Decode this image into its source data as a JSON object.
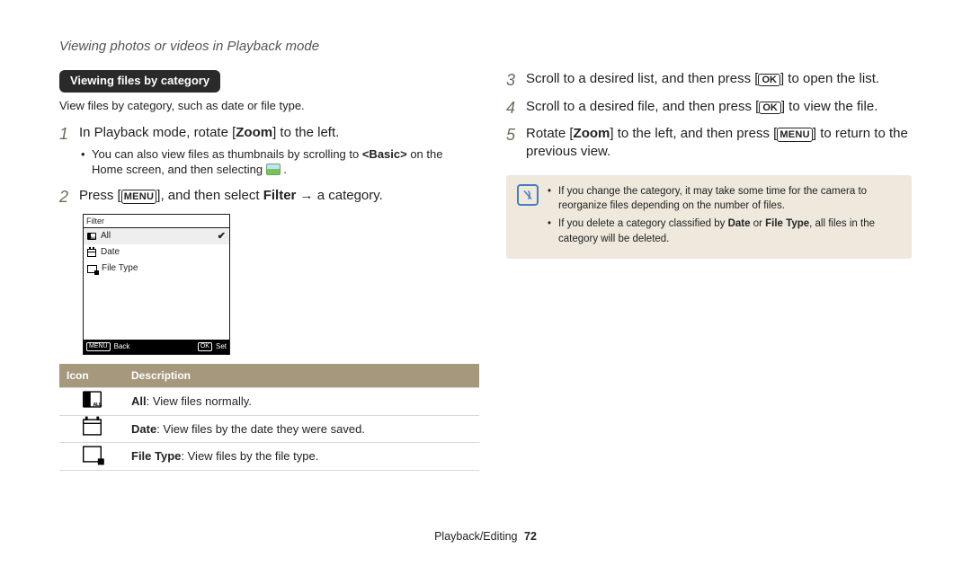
{
  "header": {
    "title": "Viewing photos or videos in Playback mode"
  },
  "section": {
    "heading": "Viewing files by category",
    "caption": "View files by category, such as date or file type."
  },
  "steps": {
    "s1": {
      "num": "1",
      "text_a": "In Playback mode, rotate [",
      "zoom": "Zoom",
      "text_b": "] to the left.",
      "sub_a": "You can also view files as thumbnails by scrolling to ",
      "basic": "<Basic>",
      "sub_b": " on the Home screen, and then selecting ",
      "sub_c": " ."
    },
    "s2": {
      "num": "2",
      "text_a": "Press [",
      "menu": "MENU",
      "text_b": "], and then select ",
      "filter": "Filter",
      "text_c": " → a category."
    },
    "s3": {
      "num": "3",
      "text_a": "Scroll to a desired list, and then press [",
      "ok": "OK",
      "text_b": "] to open the list."
    },
    "s4": {
      "num": "4",
      "text_a": "Scroll to a desired file, and then press [",
      "ok": "OK",
      "text_b": "] to view the file."
    },
    "s5": {
      "num": "5",
      "text_a": "Rotate [",
      "zoom": "Zoom",
      "text_b": "] to the left, and then press [",
      "menu": "MENU",
      "text_c": "] to return to the previous view."
    }
  },
  "filter_ui": {
    "title": "Filter",
    "all": "All",
    "date": "Date",
    "filetype": "File Type",
    "check": "✔",
    "back_btn": "MENU",
    "back_label": "Back",
    "set_btn": "OK",
    "set_label": "Set"
  },
  "icon_table": {
    "h_icon": "Icon",
    "h_desc": "Description",
    "r1_bold": "All",
    "r1_rest": ": View files normally.",
    "r2_bold": "Date",
    "r2_rest": ": View files by the date they were saved.",
    "r3_bold": "File Type",
    "r3_rest": ": View files by the file type."
  },
  "note": {
    "n1": "If you change the category, it may take some time for the camera to reorganize files depending on the number of files.",
    "n2_a": "If you delete a category classified by ",
    "n2_b": "Date",
    "n2_c": " or ",
    "n2_d": "File Type",
    "n2_e": ", all files in the category will be deleted."
  },
  "footer": {
    "section": "Playback/Editing",
    "page": "72"
  }
}
